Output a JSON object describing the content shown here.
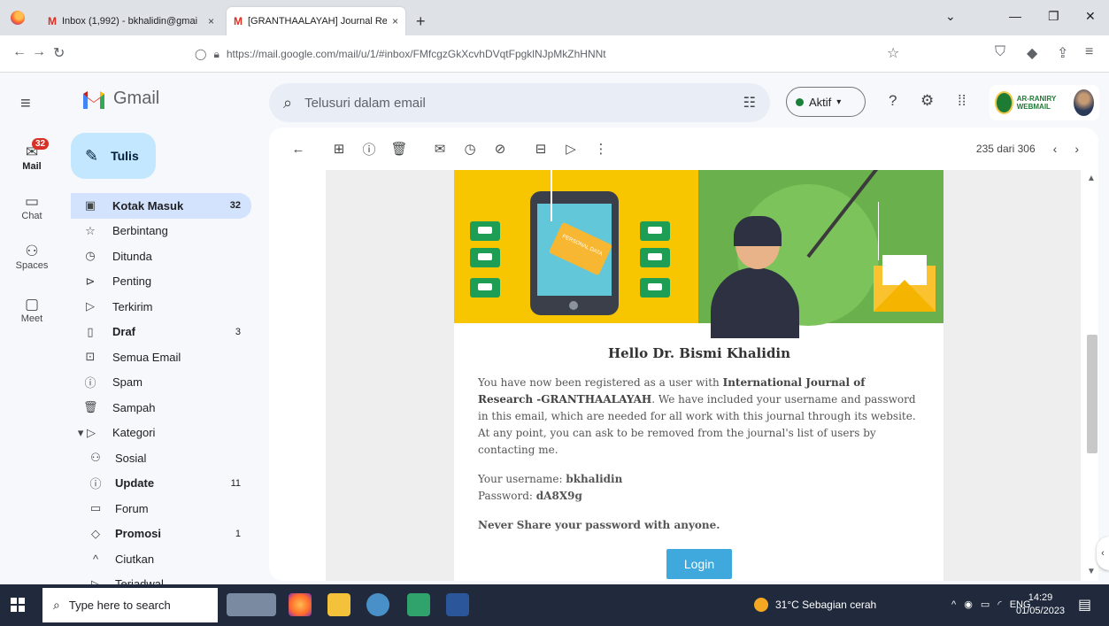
{
  "browser": {
    "tabs": [
      {
        "label": "Inbox (1,992) - bkhalidin@gmai",
        "close": "×"
      },
      {
        "label": "[GRANTHAALAYAH] Journal Re",
        "close": "×"
      }
    ],
    "new_tab": "+",
    "url": "https://mail.google.com/mail/u/1/#inbox/FMfcgzGkXcvhDVqtFpgklNJpMkZhHNNt"
  },
  "gmail": {
    "product": "Gmail",
    "search_placeholder": "Telusuri dalam email",
    "status": "Aktif",
    "account_logo_text": "AR-RANIRY WEBMAIL",
    "rail": [
      {
        "label": "Mail",
        "badge": "32"
      },
      {
        "label": "Chat"
      },
      {
        "label": "Spaces"
      },
      {
        "label": "Meet"
      }
    ],
    "compose": "Tulis",
    "folders": [
      {
        "label": "Kotak Masuk",
        "count": "32"
      },
      {
        "label": "Berbintang",
        "count": ""
      },
      {
        "label": "Ditunda",
        "count": ""
      },
      {
        "label": "Penting",
        "count": ""
      },
      {
        "label": "Terkirim",
        "count": ""
      },
      {
        "label": "Draf",
        "count": "3"
      },
      {
        "label": "Semua Email",
        "count": ""
      },
      {
        "label": "Spam",
        "count": ""
      },
      {
        "label": "Sampah",
        "count": ""
      },
      {
        "label": "Kategori",
        "count": ""
      },
      {
        "label": "Sosial",
        "count": ""
      },
      {
        "label": "Update",
        "count": "11"
      },
      {
        "label": "Forum",
        "count": ""
      },
      {
        "label": "Promosi",
        "count": "1"
      },
      {
        "label": "Ciutkan",
        "count": ""
      },
      {
        "label": "Terjadwal",
        "count": ""
      }
    ],
    "pager": "235 dari 306"
  },
  "email": {
    "banner_card_text": "PERSONAL DATA",
    "greeting": "Hello Dr. Bismi Khalidin",
    "para_pre": "You have now been registered as a user with ",
    "journal": "International Journal of Research -GRANTHAALAYAH",
    "para_post": ". We have included your username and password in this email, which are needed for all work with this journal through its website. At any point, you can ask to be removed from the journal's list of users by contacting me.",
    "username_label": "Your username: ",
    "username": "bkhalidin",
    "password_label": "Password: ",
    "password": "dA8X9g",
    "warning": "Never Share your password with anyone.",
    "login_button": "Login"
  },
  "taskbar": {
    "search_placeholder": "Type here to search",
    "weather": "31°C  Sebagian cerah",
    "lang": "ENG",
    "time": "14:29",
    "date": "01/05/2023"
  },
  "colors": {
    "accent": "#0b57d0",
    "compose": "#c2e7ff",
    "active_folder": "#d3e3fd",
    "login": "#3fa9de",
    "banner_yellow": "#f7c600",
    "banner_green": "#6ab04c"
  }
}
